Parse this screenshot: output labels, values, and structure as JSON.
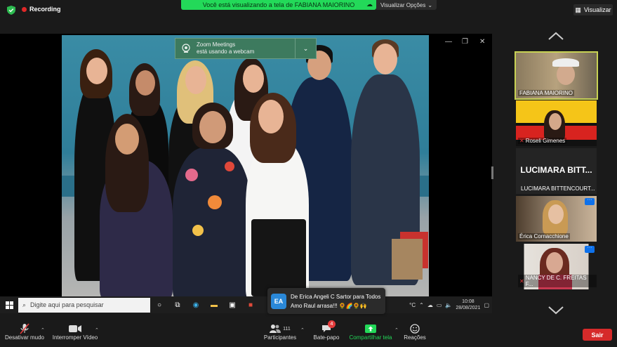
{
  "topbar": {
    "recording_label": "Recording",
    "banner_text": "Você está visualizando a tela de FABIANA MAIORINO",
    "banner_options": "Visualizar Opções",
    "view_button": "Visualizar"
  },
  "zoom_toast": {
    "line1": "Zoom Meetings",
    "line2": "está usando a webcam"
  },
  "taskbar": {
    "search_placeholder": "Digite aqui para pesquisar",
    "temp": "°C",
    "time": "10:08",
    "date": "28/08/2021"
  },
  "chat_notification": {
    "avatar_initials": "EA",
    "header": "De Erica Angeli C Sartor para Todos",
    "message": "Amo Raul arrasa!!! 🌻🌈🌻🙌"
  },
  "participants_panel": {
    "tiles": [
      {
        "name": "FABIANA MAIORINO"
      },
      {
        "name": "Roseli Gimenes"
      },
      {
        "name": "LUCIMARA BITTENCOURT...",
        "display_name": "LUCIMARA BITT..."
      },
      {
        "name": "Érica Cornacchione"
      },
      {
        "name": "NANCY DE C. FREITAS F..."
      }
    ]
  },
  "toolbar": {
    "mute_label": "Desativar mudo",
    "video_label": "Interromper Vídeo",
    "participants_label": "Participantes",
    "participants_count": "111",
    "chat_label": "Bate-papo",
    "chat_badge": "4",
    "share_label": "Compartilhar tela",
    "reactions_label": "Reações",
    "leave_label": "Sair"
  },
  "colors": {
    "banner_green": "#23d959",
    "active_outline": "#c8d254",
    "leave_red": "#d62a2a",
    "share_green": "#23d959"
  }
}
